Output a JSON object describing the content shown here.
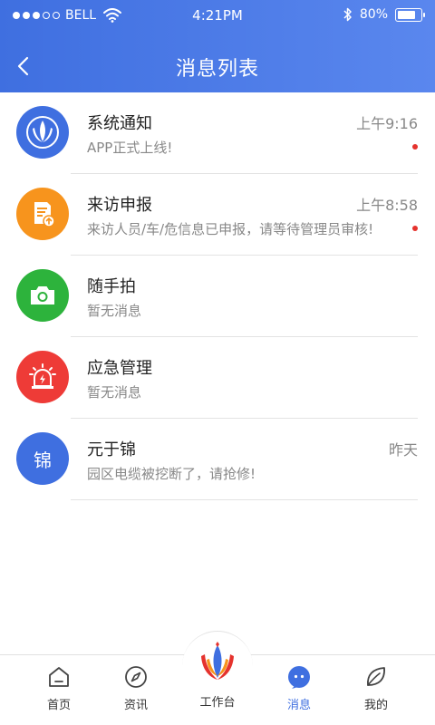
{
  "status_bar": {
    "carrier": "BELL",
    "time": "4:21PM",
    "battery": "80%"
  },
  "nav": {
    "title": "消息列表"
  },
  "messages": [
    {
      "name": "系统通知",
      "time": "上午9:16",
      "preview": "APP正式上线!",
      "unread": true,
      "color": "#3f6fe0",
      "icon": "app-logo-icon"
    },
    {
      "name": "来访申报",
      "time": "上午8:58",
      "preview": "来访人员/车/危信息已申报，请等待管理员审核!",
      "unread": true,
      "color": "#f7941d",
      "icon": "document-upload-icon"
    },
    {
      "name": "随手拍",
      "time": "",
      "preview": "暂无消息",
      "unread": false,
      "color": "#2db33c",
      "icon": "camera-icon"
    },
    {
      "name": "应急管理",
      "time": "",
      "preview": "暂无消息",
      "unread": false,
      "color": "#ee3b37",
      "icon": "alarm-light-icon"
    },
    {
      "name": "元于锦",
      "time": "昨天",
      "preview": "园区电缆被挖断了，请抢修!",
      "unread": false,
      "color": "#3f6fe0",
      "avatar_text": "锦"
    }
  ],
  "tabs": {
    "home": "首页",
    "news": "资讯",
    "workbench": "工作台",
    "messages": "消息",
    "mine": "我的"
  },
  "colors": {
    "accent": "#3f6fe0",
    "unread_dot": "#e5322d"
  }
}
